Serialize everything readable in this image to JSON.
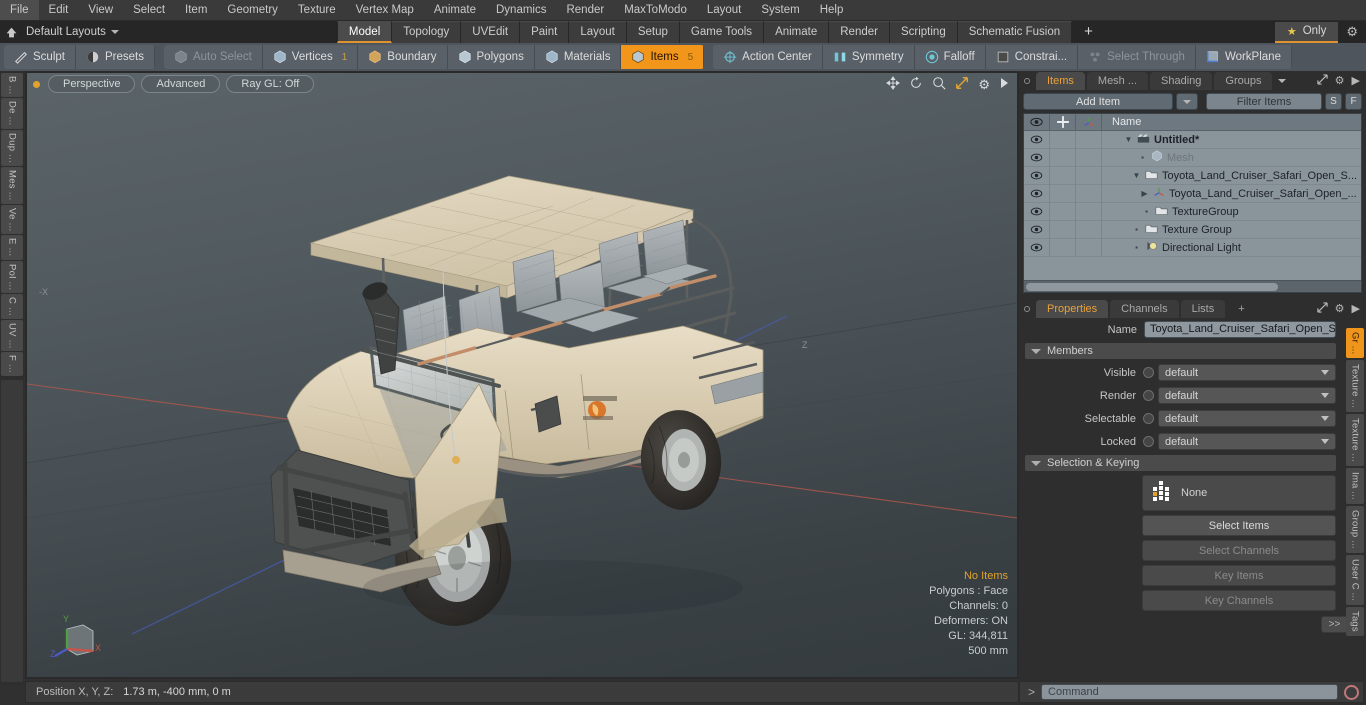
{
  "menu": {
    "items": [
      "File",
      "Edit",
      "View",
      "Select",
      "Item",
      "Geometry",
      "Texture",
      "Vertex Map",
      "Animate",
      "Dynamics",
      "Render",
      "MaxToModo",
      "Layout",
      "System",
      "Help"
    ]
  },
  "layoutbar": {
    "home_icon": "home-icon",
    "layouts_label": "Default Layouts",
    "tabs": [
      {
        "label": "Model",
        "active": true
      },
      {
        "label": "Topology",
        "active": false
      },
      {
        "label": "UVEdit",
        "active": false
      },
      {
        "label": "Paint",
        "active": false
      },
      {
        "label": "Layout",
        "active": false
      },
      {
        "label": "Setup",
        "active": false
      },
      {
        "label": "Game Tools",
        "active": false
      },
      {
        "label": "Animate",
        "active": false
      },
      {
        "label": "Render",
        "active": false
      },
      {
        "label": "Scripting",
        "active": false
      },
      {
        "label": "Schematic Fusion",
        "active": false
      }
    ],
    "add_tab": "+",
    "only_label": "Only",
    "gear_icon": "gear-icon"
  },
  "toolbar": {
    "left_group": [
      {
        "label": "Sculpt",
        "icon": "sculpt-icon",
        "state": "normal"
      },
      {
        "label": "Presets",
        "icon": "presets-icon",
        "state": "normal"
      }
    ],
    "select_group": [
      {
        "label": "Auto Select",
        "icon": "cube-icon",
        "state": "disabled",
        "count": ""
      },
      {
        "label": "Vertices",
        "icon": "cube-icon",
        "state": "normal",
        "count": "1"
      },
      {
        "label": "Boundary",
        "icon": "boundary-icon",
        "state": "normal",
        "count": ""
      },
      {
        "label": "Polygons",
        "icon": "cube-icon",
        "state": "normal",
        "count": ""
      },
      {
        "label": "Materials",
        "icon": "cube-icon",
        "state": "normal",
        "count": ""
      },
      {
        "label": "Items",
        "icon": "cube-icon",
        "state": "active",
        "count": "5"
      }
    ],
    "right_group": [
      {
        "label": "Action Center",
        "icon": "action-center-icon",
        "state": "normal"
      },
      {
        "label": "Symmetry",
        "icon": "symmetry-icon",
        "state": "normal"
      },
      {
        "label": "Falloff",
        "icon": "falloff-icon",
        "state": "normal"
      },
      {
        "label": "Constrai...",
        "icon": "constraint-icon",
        "state": "normal"
      },
      {
        "label": "Select Through",
        "icon": "select-through-icon",
        "state": "disabled"
      },
      {
        "label": "WorkPlane",
        "icon": "workplane-icon",
        "state": "normal"
      }
    ]
  },
  "left_tabs": [
    "B ...",
    "De ...",
    "Dup ...",
    "Mes ...",
    "Ve ...",
    "E ...",
    "Pol ...",
    "C ...",
    "UV ...",
    "F ..."
  ],
  "viewport": {
    "pills": [
      "Perspective",
      "Advanced",
      "Ray GL: Off"
    ],
    "header_icons": [
      "move-icon",
      "rotate-icon",
      "zoom-icon",
      "fit-icon",
      "gear-icon",
      "play-icon"
    ],
    "info": {
      "no_items": "No Items",
      "polygons": "Polygons : Face",
      "channels": "Channels: 0",
      "deformers": "Deformers: ON",
      "gl": "GL: 344,811",
      "scale": "500 mm"
    },
    "gizmo": {
      "x": "X",
      "y": "Y",
      "z": "Z"
    },
    "axis_colors": {
      "x": "#c4554a",
      "y": "#4f9f45",
      "z": "#4a5cc4"
    }
  },
  "statusbar": {
    "label": "Position X, Y, Z:",
    "value": "1.73 m, -400 mm, 0 m"
  },
  "right_panel": {
    "items_panel": {
      "tabs": [
        {
          "label": "Items",
          "active": true
        },
        {
          "label": "Mesh ...",
          "active": false
        },
        {
          "label": "Shading",
          "active": false
        },
        {
          "label": "Groups",
          "active": false
        }
      ],
      "add_item_label": "Add Item",
      "filter_placeholder": "Filter Items",
      "btn_s": "S",
      "btn_f": "F",
      "columns": {
        "eye": "eye-icon",
        "lock": "lock-icon",
        "axis": "axis-icon",
        "name": "Name"
      },
      "rows": [
        {
          "name": "Untitled*",
          "icon": "scene-icon",
          "indent": 0,
          "bold": true,
          "dim": false,
          "disclosure": "open"
        },
        {
          "name": "Mesh",
          "icon": "mesh-icon",
          "indent": 1,
          "bold": false,
          "dim": true,
          "disclosure": "none"
        },
        {
          "name": "Toyota_Land_Cruiser_Safari_Open_S...",
          "icon": "group-icon",
          "indent": 1,
          "bold": false,
          "dim": false,
          "disclosure": "open"
        },
        {
          "name": "Toyota_Land_Cruiser_Safari_Open_...",
          "icon": "locator-icon",
          "indent": 2,
          "bold": false,
          "dim": false,
          "disclosure": "closed"
        },
        {
          "name": "TextureGroup",
          "icon": "group-icon",
          "indent": 2,
          "bold": false,
          "dim": false,
          "disclosure": "none"
        },
        {
          "name": "Texture Group",
          "icon": "group-icon",
          "indent": 1,
          "bold": false,
          "dim": false,
          "disclosure": "none"
        },
        {
          "name": "Directional Light",
          "icon": "light-icon",
          "indent": 1,
          "bold": false,
          "dim": false,
          "disclosure": "none"
        }
      ]
    },
    "properties_panel": {
      "tabs": [
        {
          "label": "Properties",
          "active": true
        },
        {
          "label": "Channels",
          "active": false
        },
        {
          "label": "Lists",
          "active": false
        },
        {
          "label": "+",
          "active": false
        }
      ],
      "name_label": "Name",
      "name_value": "Toyota_Land_Cruiser_Safari_Open_Si",
      "members_section": "Members",
      "fields": [
        {
          "label": "Visible",
          "value": "default"
        },
        {
          "label": "Render",
          "value": "default"
        },
        {
          "label": "Selectable",
          "value": "default"
        },
        {
          "label": "Locked",
          "value": "default"
        }
      ],
      "selection_section": "Selection & Keying",
      "selection_value": "None",
      "buttons": [
        {
          "label": "Select Items",
          "disabled": false
        },
        {
          "label": "Select Channels",
          "disabled": true
        },
        {
          "label": "Key Items",
          "disabled": true
        },
        {
          "label": "Key Channels",
          "disabled": true
        }
      ],
      "expand_label": ">>"
    },
    "vertical_tabs": [
      {
        "label": "Gr ...",
        "active": true
      },
      {
        "label": "Texture ...",
        "active": false
      },
      {
        "label": "Texture ...",
        "active": false
      },
      {
        "label": "Ima ...",
        "active": false
      },
      {
        "label": "Group ...",
        "active": false
      },
      {
        "label": "User C ...",
        "active": false
      },
      {
        "label": "Tags",
        "active": false
      }
    ]
  },
  "command_bar": {
    "prompt": ">",
    "placeholder": "Command",
    "record_icon": "record-icon"
  },
  "colors": {
    "accent_orange": "#f2951b",
    "tab_underline": "#e0922e",
    "panel_bg": "#2e2e2e",
    "toolbar_bg": "#4f555c",
    "tree_bg": "#8a949b"
  }
}
